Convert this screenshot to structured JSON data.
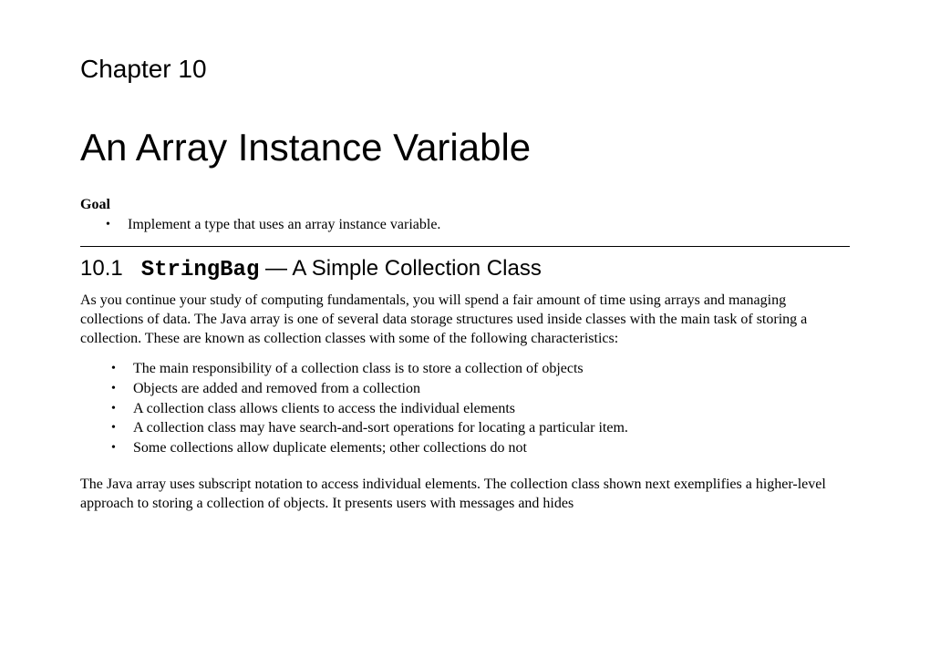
{
  "chapter": {
    "label": "Chapter 10",
    "title": "An Array Instance Variable"
  },
  "goal": {
    "heading": "Goal",
    "items": [
      "Implement a type that uses an array instance variable."
    ]
  },
  "section": {
    "number": "10.1",
    "code": "StringBag",
    "rest": " — A Simple Collection Class"
  },
  "paragraph1": "As you continue your study of computing fundamentals, you will spend a fair amount of time using arrays and managing collections of data. The Java array is one of several data storage structures used inside classes with the main task of storing a collection. These are known as collection classes with some of the following characteristics:",
  "characteristics": [
    "The main responsibility of a collection class is to store a collection of objects",
    "Objects are added and removed from a collection",
    "A collection class allows clients to access the individual elements",
    "A collection class may have search-and-sort operations for locating a particular item.",
    "Some collections allow duplicate elements; other collections do not"
  ],
  "paragraph2": "The Java array uses subscript notation to access individual elements. The collection class shown next exemplifies a higher-level approach to storing a collection of objects. It presents users with messages and hides"
}
